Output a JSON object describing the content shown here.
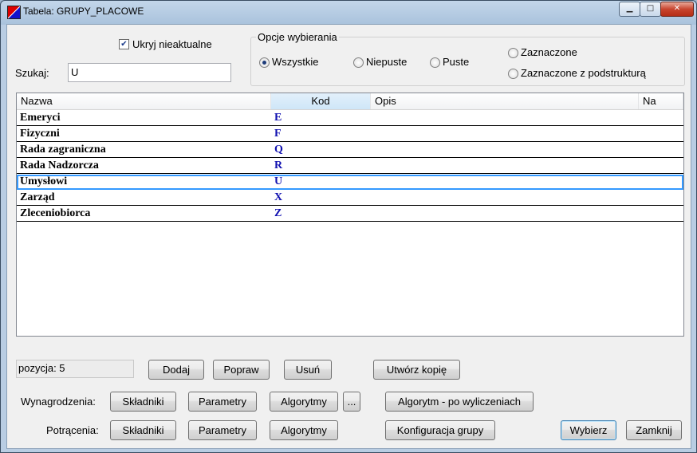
{
  "window": {
    "title": "Tabela: GRUPY_PLACOWE",
    "min_glyph": "▁",
    "max_glyph": "□",
    "close_glyph": "✕"
  },
  "filter": {
    "hide_inactive_label": "Ukryj nieaktualne",
    "hide_inactive_checked": true,
    "search_label": "Szukaj:",
    "search_value": "U"
  },
  "options": {
    "legend": "Opcje wybierania",
    "radios": [
      {
        "label": "Wszystkie",
        "checked": true
      },
      {
        "label": "Niepuste",
        "checked": false
      },
      {
        "label": "Puste",
        "checked": false
      },
      {
        "label": "Zaznaczone",
        "checked": false
      },
      {
        "label": "Zaznaczone z podstrukturą",
        "checked": false
      }
    ]
  },
  "grid": {
    "columns": [
      "Nazwa",
      "Kod",
      "Opis",
      "Na"
    ],
    "sorted_column": "Kod",
    "rows": [
      {
        "nazwa": "Emeryci",
        "kod": "E"
      },
      {
        "nazwa": "Fizyczni",
        "kod": "F"
      },
      {
        "nazwa": "Rada zagraniczna",
        "kod": "Q"
      },
      {
        "nazwa": "Rada Nadzorcza",
        "kod": "R"
      },
      {
        "nazwa": "Umysłowi",
        "kod": "U"
      },
      {
        "nazwa": "Zarząd",
        "kod": "X"
      },
      {
        "nazwa": "Zleceniobiorca",
        "kod": "Z"
      }
    ],
    "selected_row": 4
  },
  "status": {
    "position_text": "pozycja:  5"
  },
  "actions": {
    "dodaj": "Dodaj",
    "popraw": "Popraw",
    "usun": "Usuń",
    "utworz_kopie": "Utwórz kopię"
  },
  "wynagrodzenia": {
    "label": "Wynagrodzenia:",
    "skladniki": "Składniki",
    "parametry": "Parametry",
    "algorytmy": "Algorytmy",
    "more": "...",
    "algorytm_po": "Algorytm - po wyliczeniach"
  },
  "potracenia": {
    "label": "Potrącenia:",
    "skladniki": "Składniki",
    "parametry": "Parametry",
    "algorytmy": "Algorytmy",
    "konfiguracja": "Konfiguracja grupy"
  },
  "footer": {
    "wybierz": "Wybierz",
    "zamknij": "Zamknij"
  }
}
